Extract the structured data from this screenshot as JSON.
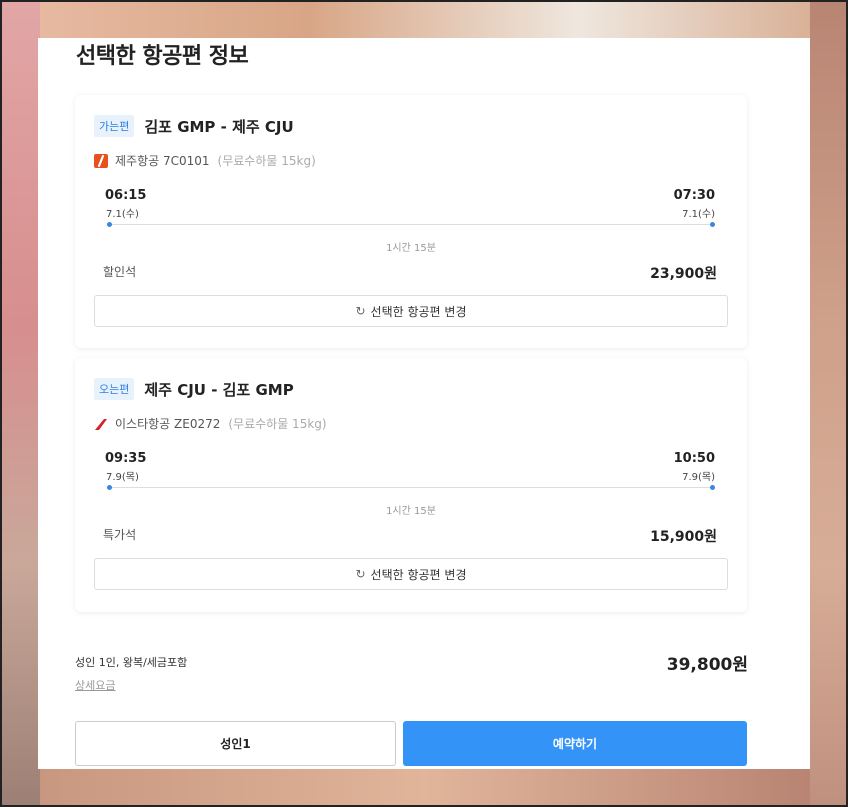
{
  "page_title": "선택한 항공편 정보",
  "outbound": {
    "badge": "가는편",
    "route": "김포 GMP - 제주 CJU",
    "airline": "제주항공 7C0101",
    "baggage": "(무료수하물 15kg)",
    "dep_time": "06:15",
    "dep_date": "7.1(수)",
    "arr_time": "07:30",
    "arr_date": "7.1(수)",
    "duration": "1시간 15분",
    "seat_class": "할인석",
    "fare": "23,900원",
    "change_label": "선택한 항공편 변경",
    "logo_color": "#e8501d"
  },
  "inbound": {
    "badge": "오는편",
    "route": "제주 CJU - 김포 GMP",
    "airline": "이스타항공 ZE0272",
    "baggage": "(무료수하물 15kg)",
    "dep_time": "09:35",
    "dep_date": "7.9(목)",
    "arr_time": "10:50",
    "arr_date": "7.9(목)",
    "duration": "1시간 15분",
    "seat_class": "특가석",
    "fare": "15,900원",
    "change_label": "선택한 항공편 변경",
    "logo_color": "#d6202a"
  },
  "summary": {
    "label": "성인 1인, 왕복/세금포함",
    "detail_link": "상세요금",
    "total": "39,800원"
  },
  "footer": {
    "pax_label": "성인1",
    "book_label": "예약하기"
  },
  "colors": {
    "accent": "#3493f7",
    "badge_text": "#2f7fe0",
    "badge_bg": "#e8f2fd"
  }
}
